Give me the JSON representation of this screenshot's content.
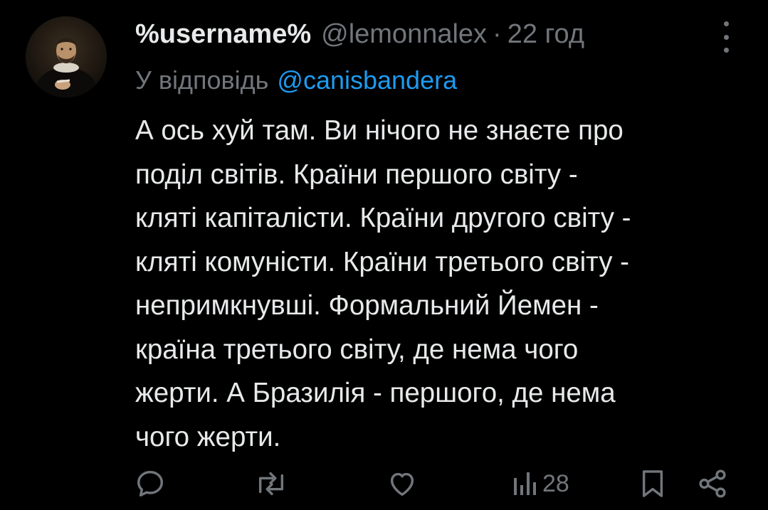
{
  "tweet": {
    "display_name": "%username%",
    "handle": "@lemonnalex",
    "separator": "·",
    "time": "22 год",
    "reply_prefix": "У відповідь",
    "reply_to": "@canisbandera",
    "text_lines": [
      "А ось хуй там. Ви нічого не знаєте про",
      "поділ світів. Країни першого світу -",
      "кляті капіталісти. Країни другого світу -",
      "кляті комуністи. Країни третього світу -",
      "непримкнувші. Формальний Йемен -",
      "країна третього світу, де нема чого",
      "жерти. А Бразилія - першого, де нема",
      "чого жерти."
    ]
  },
  "actions": {
    "views_count": "28",
    "icons": [
      "reply-icon",
      "retweet-icon",
      "like-icon",
      "views-icon",
      "bookmark-icon",
      "share-icon"
    ]
  },
  "colors": {
    "background": "#000000",
    "text": "#e7e9ea",
    "secondary": "#71767b",
    "accent": "#1d9bf0"
  }
}
